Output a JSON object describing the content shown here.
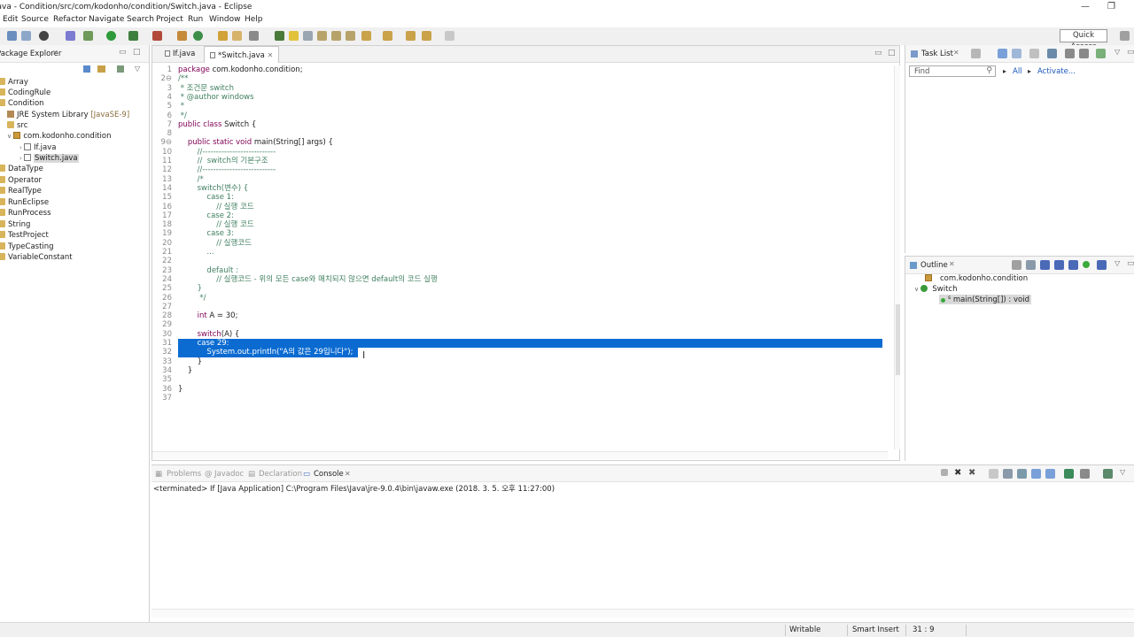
{
  "window": {
    "title": "java - Condition/src/com/kodonho/condition/Switch.java - Eclipse"
  },
  "menu": [
    "Edit",
    "Source",
    "Refactor",
    "Navigate",
    "Search",
    "Project",
    "Run",
    "Window",
    "Help"
  ],
  "toolbar": {
    "quick_access": "Quick Access"
  },
  "package_explorer": {
    "title": "Package Explorer",
    "items": [
      "Array",
      "CodingRule",
      "Condition",
      "JRE System Library",
      "[JavaSE-9]",
      "src",
      "com.kodonho.condition",
      "If.java",
      "Switch.java",
      "DataType",
      "Operator",
      "RealType",
      "RunEclipse",
      "RunProcess",
      "String",
      "TestProject",
      "TypeCasting",
      "VariableConstant"
    ]
  },
  "editor": {
    "tabs": [
      "If.java",
      "*Switch.java"
    ],
    "line_numbers": [
      "1",
      "2⊖",
      "3",
      "4",
      "5",
      "6",
      "7",
      "8",
      "9⊖",
      "10",
      "11",
      "12",
      "13",
      "14",
      "15",
      "16",
      "17",
      "18",
      "19",
      "20",
      "21",
      "22",
      "23",
      "24",
      "25",
      "26",
      "27",
      "28",
      "29",
      "30",
      "31",
      "32",
      "33",
      "34",
      "35",
      "36",
      "37"
    ],
    "lines": [
      {
        "k": "package",
        "t": " com.kodonho.condition;"
      },
      {
        "c": "/**"
      },
      {
        "c": " * 조건문 switch"
      },
      {
        "c": " * @author windows"
      },
      {
        "c": " *"
      },
      {
        "c": " */"
      },
      {
        "k": "public class",
        "t": " Switch {"
      },
      {
        "t": ""
      },
      {
        "t": "    ",
        "k": "public static void",
        "t2": " main(String[] args) {"
      },
      {
        "c": "        //---------------------------"
      },
      {
        "c": "        //  switch의 기본구조"
      },
      {
        "c": "        //---------------------------"
      },
      {
        "c": "        /*"
      },
      {
        "c": "        switch(변수) {"
      },
      {
        "c": "            case 1:"
      },
      {
        "c": "                // 실행 코드"
      },
      {
        "c": "            case 2:"
      },
      {
        "c": "                // 실행 코드"
      },
      {
        "c": "            case 3:"
      },
      {
        "c": "                // 실행코드"
      },
      {
        "c": "            ..."
      },
      {
        "t": ""
      },
      {
        "c": "            default :"
      },
      {
        "c": "                // 실행코드 - 위의 모든 case와 매치되지 않으면 default의 코드 실행"
      },
      {
        "c": "        }"
      },
      {
        "c": "         */"
      },
      {
        "t": ""
      },
      {
        "t": "        ",
        "k": "int",
        "t2": " A = 30;"
      },
      {
        "t": ""
      },
      {
        "t": "        ",
        "k": "switch",
        "t2": "(A) {"
      },
      {
        "sel": "        case 29:"
      },
      {
        "sel": "            System.out.println(\"A의 값은 29입니다\");"
      },
      {
        "t": "        }"
      },
      {
        "t": "    }"
      },
      {
        "t": ""
      },
      {
        "t": "}"
      },
      {
        "t": ""
      }
    ]
  },
  "task_list": {
    "title": "Task List",
    "find_placeholder": "Find",
    "all": "All",
    "activate": "Activate..."
  },
  "outline": {
    "title": "Outline",
    "items": [
      "com.kodonho.condition",
      "Switch",
      "main(String[]) : void"
    ]
  },
  "bottom": {
    "tabs": [
      "Problems",
      "Javadoc",
      "Declaration",
      "Console"
    ],
    "console_text": "<terminated> If [Java Application] C:\\Program Files\\Java\\jre-9.0.4\\bin\\javaw.exe (2018. 3. 5. 오후 11:27:00)"
  },
  "status": {
    "writable": "Writable",
    "insert": "Smart Insert",
    "position": "31 : 9"
  }
}
